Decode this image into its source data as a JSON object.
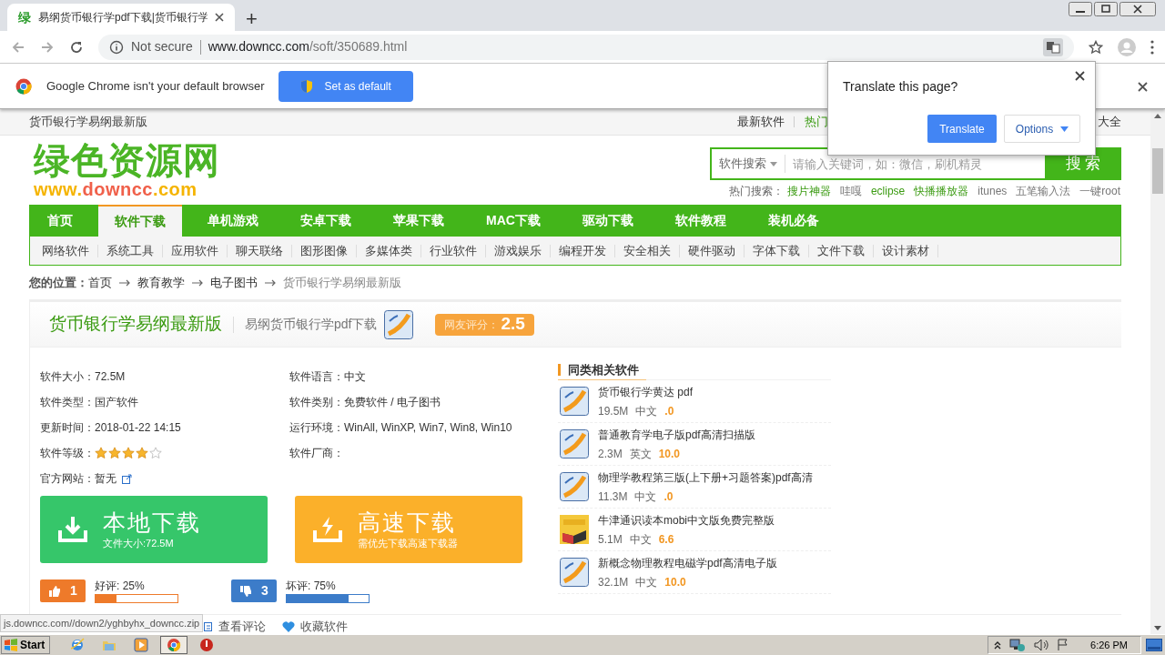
{
  "browser": {
    "tab": {
      "favicon": "绿",
      "title": "易纲货币银行学pdf下载|货币银行学"
    },
    "new_tab": "+",
    "omnibox": {
      "security": "Not secure",
      "url_host": "www.downcc.com",
      "url_path": "/soft/350689.html"
    }
  },
  "infobar": {
    "message": "Google Chrome isn't your default browser",
    "button": "Set as default"
  },
  "translate_popup": {
    "title": "Translate this page?",
    "translate_button": "Translate",
    "options_button": "Options"
  },
  "page": {
    "topbar": {
      "page_name": "货币银行学易纲最新版",
      "links": [
        "最新软件",
        "热门"
      ],
      "links_right": [
        "大全"
      ]
    },
    "logo": {
      "title": "绿色资源网",
      "url_parts": [
        {
          "text": "www.",
          "color": "#f5b400"
        },
        {
          "text": "downcc",
          "color": "#f0604a"
        },
        {
          "text": ".com",
          "color": "#f5b400"
        }
      ]
    },
    "search": {
      "scope": "软件搜索",
      "placeholder": "请输入关键词，如：微信，刷机精灵",
      "button": "搜 索"
    },
    "hot_search": {
      "label": "热门搜索：",
      "items": [
        {
          "text": "搜片神器",
          "highlighted": true
        },
        {
          "text": "哇嘎",
          "highlighted": false
        },
        {
          "text": "eclipse",
          "highlighted": true
        },
        {
          "text": "快播播放器",
          "highlighted": true
        },
        {
          "text": "itunes",
          "highlighted": false
        },
        {
          "text": "五笔输入法",
          "highlighted": false
        },
        {
          "text": "一键root",
          "highlighted": false
        }
      ]
    },
    "nav": [
      {
        "label": "首页",
        "selected": false
      },
      {
        "label": "软件下载",
        "selected": true
      },
      {
        "label": "单机游戏",
        "selected": false
      },
      {
        "label": "安卓下载",
        "selected": false
      },
      {
        "label": "苹果下载",
        "selected": false
      },
      {
        "label": "MAC下载",
        "selected": false
      },
      {
        "label": "驱动下载",
        "selected": false
      },
      {
        "label": "软件教程",
        "selected": false
      },
      {
        "label": "装机必备",
        "selected": false
      }
    ],
    "subnav": [
      "网络软件",
      "系统工具",
      "应用软件",
      "聊天联络",
      "图形图像",
      "多媒体类",
      "行业软件",
      "游戏娱乐",
      "编程开发",
      "安全相关",
      "硬件驱动",
      "字体下载",
      "文件下载",
      "设计素材"
    ],
    "breadcrumb": {
      "label": "您的位置：",
      "items": [
        "首页",
        "教育教学",
        "电子图书",
        "货币银行学易纲最新版"
      ]
    },
    "software": {
      "title": "货币银行学易纲最新版",
      "subtitle": "易纲货币银行学pdf下载",
      "rating_label": "网友评分：",
      "rating": "2.5",
      "info": [
        {
          "kind": "text",
          "label": "软件大小：",
          "value": "72.5M"
        },
        {
          "kind": "text",
          "label": "软件语言：",
          "value": "中文"
        },
        {
          "kind": "text",
          "label": "软件类型：",
          "value": "国产软件"
        },
        {
          "kind": "text",
          "label": "软件类别：",
          "value": "免费软件 / 电子图书"
        },
        {
          "kind": "text",
          "label": "更新时间：",
          "value": "2018-01-22 14:15"
        },
        {
          "kind": "text",
          "label": "运行环境：",
          "value": "WinAll, WinXP, Win7, Win8, Win10"
        },
        {
          "kind": "stars",
          "label": "软件等级：",
          "stars": 4
        },
        {
          "kind": "text",
          "label": "软件厂商："
        },
        {
          "kind": "link",
          "label": "官方网站：",
          "value": "暂无"
        }
      ],
      "downloads": [
        {
          "kind": "local",
          "title": "本地下载",
          "subtitle": "文件大小:72.5M"
        },
        {
          "kind": "fast",
          "title": "高速下载",
          "subtitle": "需优先下载高速下载器"
        }
      ],
      "votes": [
        {
          "kind": "up",
          "count": "1",
          "label": "好评: 25%",
          "level": 0.25
        },
        {
          "kind": "down",
          "count": "3",
          "label": "坏评: 75%",
          "level": 0.75
        }
      ],
      "actions": [
        {
          "kind": "comments",
          "label": "查看评论"
        },
        {
          "kind": "favorite",
          "label": "收藏软件"
        }
      ]
    },
    "related": {
      "title": "同类相关软件",
      "items": [
        {
          "kind": "pdf",
          "name": "货币银行学黄达 pdf",
          "size": "19.5M",
          "lang": "中文",
          "score": ".0"
        },
        {
          "kind": "pdf",
          "name": "普通教育学电子版pdf高清扫描版",
          "size": "2.3M",
          "lang": "英文",
          "score": "10.0"
        },
        {
          "kind": "pdf",
          "name": "物理学教程第三版(上下册+习题答案)pdf高清",
          "size": "11.3M",
          "lang": "中文",
          "score": ".0"
        },
        {
          "kind": "book",
          "name": "牛津通识读本mobi中文版免费完整版",
          "size": "5.1M",
          "lang": "中文",
          "score": "6.6"
        },
        {
          "kind": "pdf",
          "name": "新概念物理教程电磁学pdf高清电子版",
          "size": "32.1M",
          "lang": "中文",
          "score": "10.0"
        }
      ]
    }
  },
  "status_bubble": "js.downcc.com//down2/yghbyhx_downcc.zip",
  "taskbar": {
    "start": "Start",
    "pinned": [
      {
        "kind": "ie",
        "selected": false
      },
      {
        "kind": "folder",
        "selected": false
      },
      {
        "kind": "media",
        "selected": false
      },
      {
        "kind": "chrome",
        "selected": true
      },
      {
        "kind": "app",
        "selected": false
      }
    ],
    "clock": "6:26 PM"
  }
}
